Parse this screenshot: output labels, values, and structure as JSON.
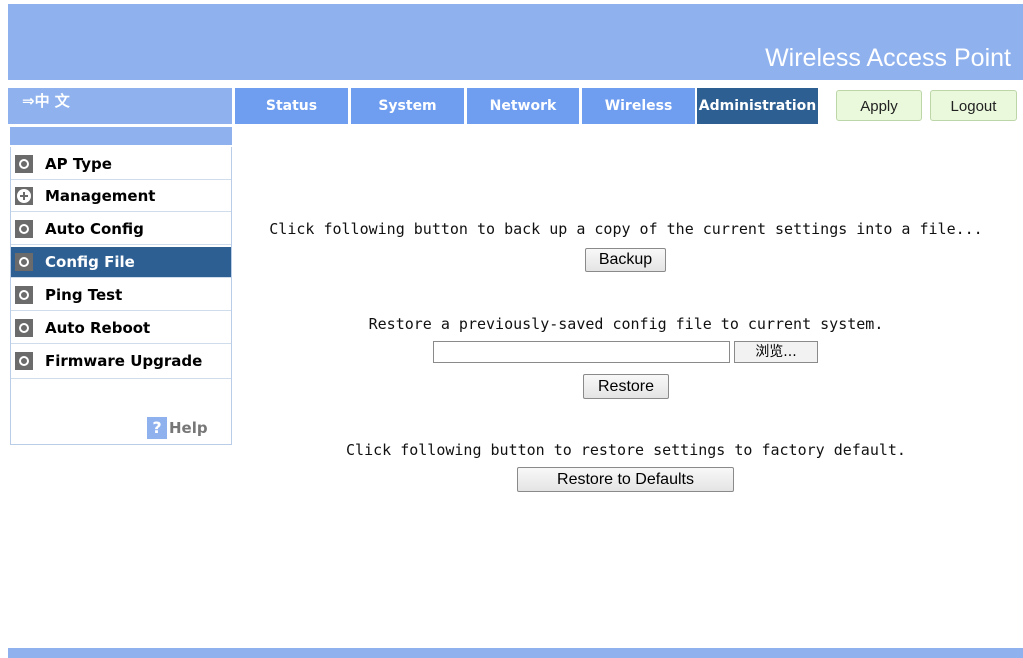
{
  "header": {
    "title": "Wireless Access Point"
  },
  "language": {
    "label": "⇒中 文"
  },
  "nav": {
    "tabs": [
      {
        "label": "Status"
      },
      {
        "label": "System"
      },
      {
        "label": "Network"
      },
      {
        "label": "Wireless"
      },
      {
        "label": "Administration",
        "active": true
      }
    ],
    "apply_label": "Apply",
    "logout_label": "Logout"
  },
  "sidebar": {
    "items": [
      {
        "label": "AP Type",
        "icon": "circle-icon"
      },
      {
        "label": "Management",
        "icon": "plus-icon"
      },
      {
        "label": "Auto Config",
        "icon": "circle-icon"
      },
      {
        "label": "Config File",
        "icon": "circle-icon",
        "active": true
      },
      {
        "label": "Ping Test",
        "icon": "circle-icon"
      },
      {
        "label": "Auto Reboot",
        "icon": "circle-icon"
      },
      {
        "label": "Firmware Upgrade",
        "icon": "circle-icon"
      }
    ],
    "help_icon": "?",
    "help_label": "Help"
  },
  "main": {
    "backup_text": "Click following button to back up a copy of the current settings into a file...",
    "backup_button": "Backup",
    "restore_text": "Restore a previously-saved config file to current system.",
    "file_input_value": "",
    "browse_button": "浏览...",
    "restore_button": "Restore",
    "defaults_text": "Click following button to restore settings to factory default.",
    "defaults_button": "Restore to Defaults"
  },
  "colors": {
    "header_bg": "#8fb2ef",
    "tab_bg": "#6f9ef0",
    "tab_active_bg": "#2e5f92",
    "action_button_bg": "#eaf9dc"
  }
}
